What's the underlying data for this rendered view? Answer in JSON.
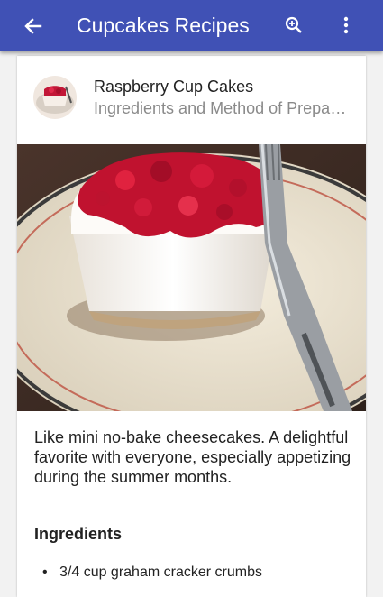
{
  "appbar": {
    "title": "Cupcakes Recipes",
    "back_icon": "arrow-left-icon",
    "zoom_icon": "zoom-in-icon",
    "more_icon": "more-vert-icon",
    "color": "#4051b5"
  },
  "recipe": {
    "title": "Raspberry Cup Cakes",
    "subtitle": "Ingredients and Method of Preparation",
    "description": "Like mini no-bake cheesecakes. A delightful favorite with everyone, especially appetizing during the summer months.",
    "ingredients_heading": "Ingredients",
    "ingredients": [
      "3/4 cup graham cracker crumbs"
    ]
  }
}
